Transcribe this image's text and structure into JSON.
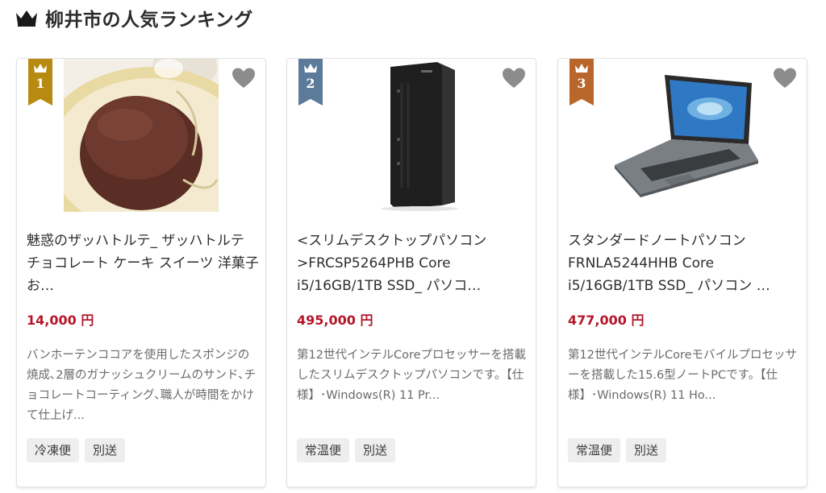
{
  "header": {
    "title": "柳井市の人気ランキング",
    "icon": "crown-icon"
  },
  "colors": {
    "gold": "#b78a12",
    "silver": "#5c7a99",
    "bronze": "#b8662a",
    "price": "#b5172a",
    "heart": "#8c8c8c"
  },
  "products": [
    {
      "rank": "1",
      "name": "魅惑のザッハトルテ_ ザッハトルテ チョコレート ケーキ スイーツ 洋菓子 お…",
      "price": "14,000 円",
      "description": "バンホーテンココアを使用したスポンジの焼成､2層のガナッシュクリームのサンド､チョコレートコーティング､職人が時間をかけて仕上げ...",
      "tags": [
        "冷凍便",
        "別送"
      ]
    },
    {
      "rank": "2",
      "name": "<スリムデスクトップパソコン>FRCSP5264PHB Core i5/16GB/1TB SSD_ パソコ…",
      "price": "495,000 円",
      "description": "第12世代インテルCoreプロセッサーを搭載したスリムデスクトップパソコンです。【仕様】･Windows(R) 11 Pr...",
      "tags": [
        "常温便",
        "別送"
      ]
    },
    {
      "rank": "3",
      "name": "スタンダードノートパソコン FRNLA5244HHB Core i5/16GB/1TB SSD_ パソコン …",
      "price": "477,000 円",
      "description": "第12世代インテルCoreモバイルプロセッサーを搭載した15.6型ノートPCです。【仕様】･Windows(R) 11 Ho...",
      "tags": [
        "常温便",
        "別送"
      ]
    }
  ]
}
